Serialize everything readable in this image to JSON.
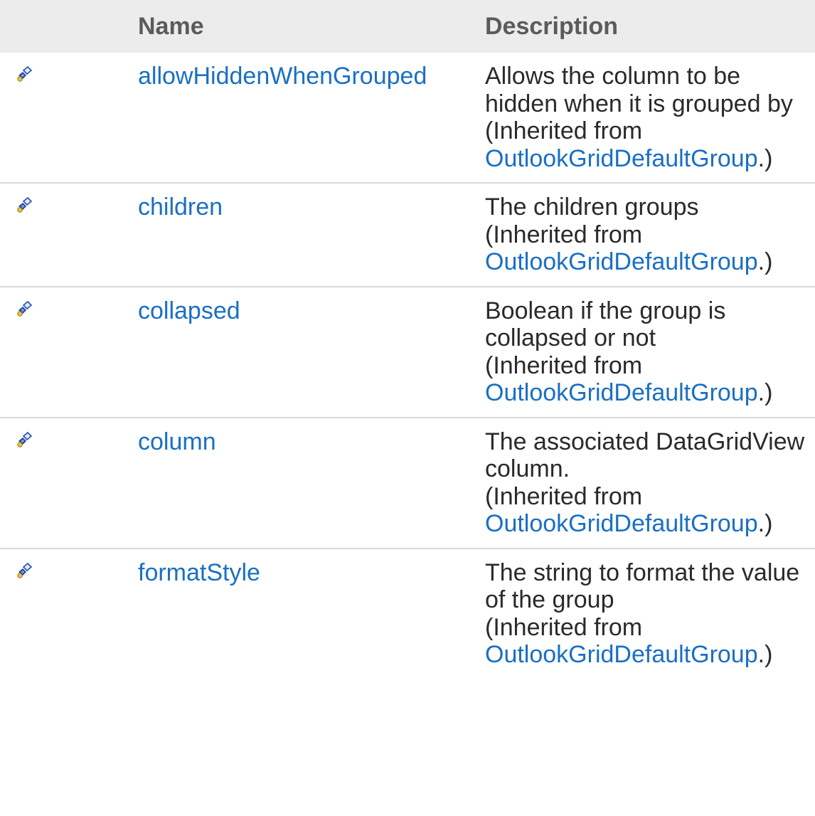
{
  "table": {
    "headers": {
      "icon": "",
      "name": "Name",
      "description": "Description"
    },
    "rows": [
      {
        "icon": "public-property-icon",
        "name": "allowHiddenWhenGrouped",
        "description": "Allows the column to be hidden when it is grouped by",
        "inherited_prefix": "(Inherited from ",
        "inherited_link": "OutlookGridDefaultGroup",
        "inherited_suffix": ".)"
      },
      {
        "icon": "public-property-icon",
        "name": "children",
        "description": "The children groups",
        "inherited_prefix": "(Inherited from ",
        "inherited_link": "OutlookGridDefaultGroup",
        "inherited_suffix": ".)"
      },
      {
        "icon": "public-property-icon",
        "name": "collapsed",
        "description": "Boolean if the group is collapsed or not",
        "inherited_prefix": "(Inherited from ",
        "inherited_link": "OutlookGridDefaultGroup",
        "inherited_suffix": ".)"
      },
      {
        "icon": "public-property-icon",
        "name": "column",
        "description": "The associated DataGridView column.",
        "inherited_prefix": "(Inherited from ",
        "inherited_link": "OutlookGridDefaultGroup",
        "inherited_suffix": ".)"
      },
      {
        "icon": "public-property-icon",
        "name": "formatStyle",
        "description": "The string to format the value of the group",
        "inherited_prefix": "(Inherited from ",
        "inherited_link": "OutlookGridDefaultGroup",
        "inherited_suffix": ".)"
      }
    ]
  },
  "colors": {
    "link": "#1a6fc4",
    "header_bg": "#ececec",
    "row_divider": "#d9d9d9"
  }
}
